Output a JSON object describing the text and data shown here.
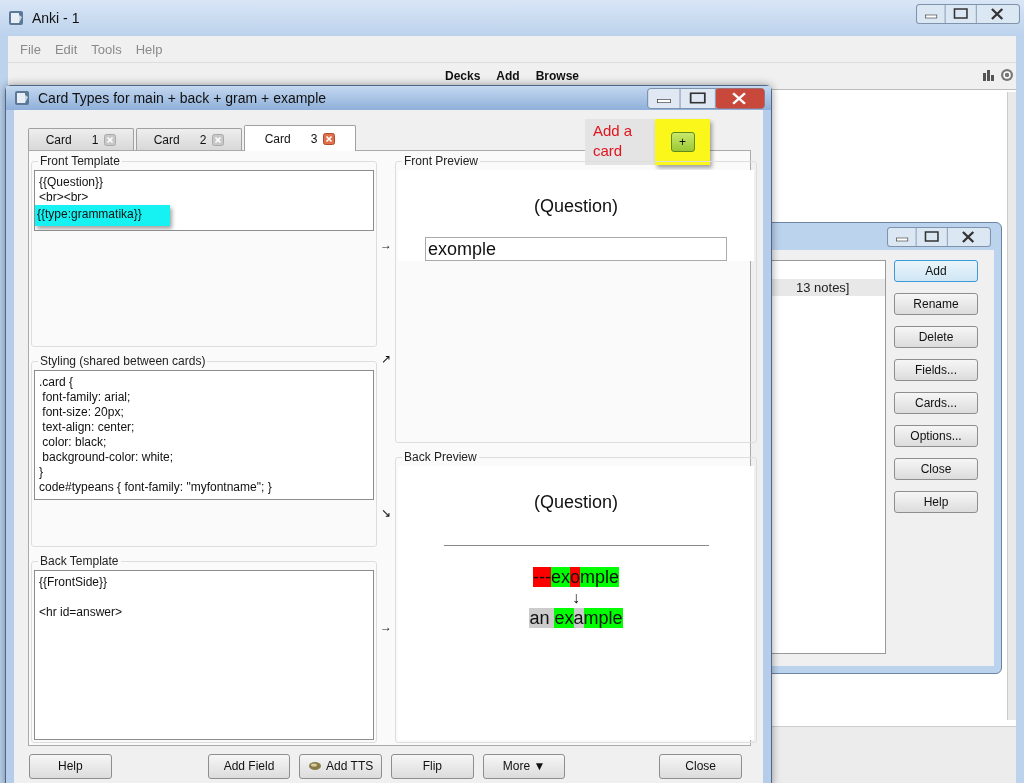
{
  "main_window": {
    "title": "Anki - 1",
    "menu": [
      "File",
      "Edit",
      "Tools",
      "Help"
    ],
    "toolbar": [
      "Decks",
      "Add",
      "Browse"
    ]
  },
  "note_types_window": {
    "selected_row": "13 notes]",
    "buttons": [
      {
        "label": "Add",
        "default": true
      },
      {
        "label": "Rename",
        "default": false
      },
      {
        "label": "Delete",
        "default": false
      },
      {
        "label": "Fields...",
        "default": false
      },
      {
        "label": "Cards...",
        "default": false
      },
      {
        "label": "Options...",
        "default": false
      },
      {
        "label": "Close",
        "default": false
      },
      {
        "label": "Help",
        "default": false
      }
    ]
  },
  "card_types_dialog": {
    "title": "Card Types for main + back + gram + example",
    "tabs": [
      {
        "label": "Card",
        "number": "1",
        "selected": false
      },
      {
        "label": "Card",
        "number": "2",
        "selected": false
      },
      {
        "label": "Card",
        "number": "3",
        "selected": true
      }
    ],
    "annotation": {
      "text": "Add a card",
      "button": "+"
    },
    "front_template": {
      "legend": "Front Template",
      "lines": [
        {
          "text": "{{Question}}",
          "highlighted": false
        },
        {
          "text": "<br><br>",
          "highlighted": false
        },
        {
          "text": "{{type:grammatika}}",
          "highlighted": true
        }
      ],
      "arrow": "→"
    },
    "styling": {
      "legend": "Styling (shared between cards)",
      "text": ".card {\n font-family: arial;\n font-size: 20px;\n text-align: center;\n color: black;\n background-color: white;\n}\ncode#typeans { font-family: \"myfontname\"; }",
      "arrow_up": "↗",
      "arrow_down": "↘"
    },
    "back_template": {
      "legend": "Back Template",
      "text": "{{FrontSide}}\n\n<hr id=answer>",
      "arrow": "→"
    },
    "front_preview": {
      "legend": "Front Preview",
      "question": "(Question)",
      "answer_value": "exomple"
    },
    "back_preview": {
      "legend": "Back Preview",
      "question": "(Question)",
      "typed": [
        {
          "text": "---",
          "kind": "bad"
        },
        {
          "text": "ex",
          "kind": "good"
        },
        {
          "text": "o",
          "kind": "bad"
        },
        {
          "text": "mple",
          "kind": "good"
        }
      ],
      "arrow": "↓",
      "correct": [
        {
          "text": "an ",
          "kind": "missed"
        },
        {
          "text": "ex",
          "kind": "good"
        },
        {
          "text": "a",
          "kind": "missed"
        },
        {
          "text": "mple",
          "kind": "good"
        }
      ]
    },
    "buttons": [
      {
        "label": "Help",
        "icon": false
      },
      {
        "label": "Add Field",
        "icon": false
      },
      {
        "label": "Add TTS",
        "icon": true
      },
      {
        "label": "Flip",
        "icon": false
      },
      {
        "label": "More ▼",
        "icon": false
      },
      {
        "label": "Close",
        "icon": false
      }
    ]
  }
}
